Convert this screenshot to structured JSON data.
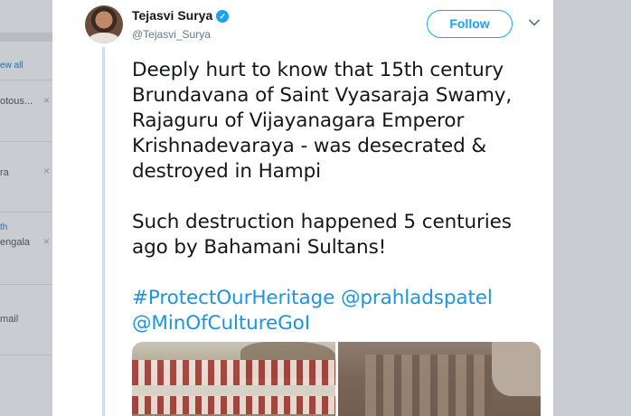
{
  "background_sidebar": {
    "items": [
      {
        "text": "ew all",
        "type": "link"
      },
      {
        "text": "otous...",
        "type": "text"
      },
      {
        "text": "ra",
        "type": "text"
      },
      {
        "text": "th",
        "type": "link"
      },
      {
        "text": "engala",
        "type": "text"
      },
      {
        "text": "mail",
        "type": "text"
      }
    ],
    "close_glyph": "×"
  },
  "tweet": {
    "author_name": "Tejasvi Surya",
    "author_handle": "@Tejasvi_Surya",
    "verified_icon": "verified-badge-icon",
    "follow_label": "Follow",
    "text_lines": [
      "Deeply hurt to know that 15th century",
      "Brundavana of Saint Vyasaraja Swamy,",
      "Rajaguru of Vijayanagara Emperor",
      "Krishnadevaraya - was desecrated &",
      "destroyed in Hampi"
    ],
    "text_lines_2": [
      "Such destruction happened 5 centuries",
      "ago by Bahamani Sultans!"
    ],
    "hashtag": "#ProtectOurHeritage",
    "mention_1": "@prahladspatel",
    "mention_2": "@MinOfCultureGoI"
  },
  "colors": {
    "accent": "#1da1f2",
    "link": "#1b95e0",
    "text": "#14171a",
    "muted": "#657786",
    "thread_line": "#c4e0f5"
  }
}
